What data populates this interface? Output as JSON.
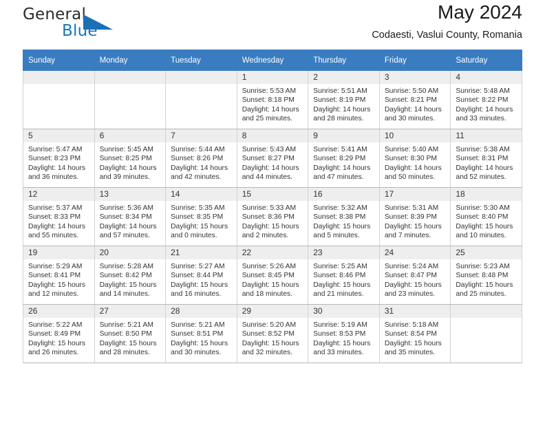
{
  "brand": {
    "line1": "General",
    "line2": "Blue",
    "triangle_icon": "triangle-icon",
    "color_dark": "#2b2b2b",
    "color_blue": "#1b75bb"
  },
  "header": {
    "title": "May 2024",
    "subtitle": "Codaesti, Vaslui County, Romania"
  },
  "theme": {
    "header_bg": "#3a7cc0",
    "daynum_bg": "#eeeeee",
    "grid_border": "#d2d2d2",
    "text": "#333333"
  },
  "weekdays": [
    "Sunday",
    "Monday",
    "Tuesday",
    "Wednesday",
    "Thursday",
    "Friday",
    "Saturday"
  ],
  "labels": {
    "sunrise": "Sunrise:",
    "sunset": "Sunset:",
    "daylight": "Daylight:"
  },
  "weeks": [
    [
      {
        "day": "",
        "blank": true
      },
      {
        "day": "",
        "blank": true
      },
      {
        "day": "",
        "blank": true
      },
      {
        "day": "1",
        "sunrise": "Sunrise: 5:53 AM",
        "sunset": "Sunset: 8:18 PM",
        "daylight1": "Daylight: 14 hours",
        "daylight2": "and 25 minutes."
      },
      {
        "day": "2",
        "sunrise": "Sunrise: 5:51 AM",
        "sunset": "Sunset: 8:19 PM",
        "daylight1": "Daylight: 14 hours",
        "daylight2": "and 28 minutes."
      },
      {
        "day": "3",
        "sunrise": "Sunrise: 5:50 AM",
        "sunset": "Sunset: 8:21 PM",
        "daylight1": "Daylight: 14 hours",
        "daylight2": "and 30 minutes."
      },
      {
        "day": "4",
        "sunrise": "Sunrise: 5:48 AM",
        "sunset": "Sunset: 8:22 PM",
        "daylight1": "Daylight: 14 hours",
        "daylight2": "and 33 minutes."
      }
    ],
    [
      {
        "day": "5",
        "sunrise": "Sunrise: 5:47 AM",
        "sunset": "Sunset: 8:23 PM",
        "daylight1": "Daylight: 14 hours",
        "daylight2": "and 36 minutes."
      },
      {
        "day": "6",
        "sunrise": "Sunrise: 5:45 AM",
        "sunset": "Sunset: 8:25 PM",
        "daylight1": "Daylight: 14 hours",
        "daylight2": "and 39 minutes."
      },
      {
        "day": "7",
        "sunrise": "Sunrise: 5:44 AM",
        "sunset": "Sunset: 8:26 PM",
        "daylight1": "Daylight: 14 hours",
        "daylight2": "and 42 minutes."
      },
      {
        "day": "8",
        "sunrise": "Sunrise: 5:43 AM",
        "sunset": "Sunset: 8:27 PM",
        "daylight1": "Daylight: 14 hours",
        "daylight2": "and 44 minutes."
      },
      {
        "day": "9",
        "sunrise": "Sunrise: 5:41 AM",
        "sunset": "Sunset: 8:29 PM",
        "daylight1": "Daylight: 14 hours",
        "daylight2": "and 47 minutes."
      },
      {
        "day": "10",
        "sunrise": "Sunrise: 5:40 AM",
        "sunset": "Sunset: 8:30 PM",
        "daylight1": "Daylight: 14 hours",
        "daylight2": "and 50 minutes."
      },
      {
        "day": "11",
        "sunrise": "Sunrise: 5:38 AM",
        "sunset": "Sunset: 8:31 PM",
        "daylight1": "Daylight: 14 hours",
        "daylight2": "and 52 minutes."
      }
    ],
    [
      {
        "day": "12",
        "sunrise": "Sunrise: 5:37 AM",
        "sunset": "Sunset: 8:33 PM",
        "daylight1": "Daylight: 14 hours",
        "daylight2": "and 55 minutes."
      },
      {
        "day": "13",
        "sunrise": "Sunrise: 5:36 AM",
        "sunset": "Sunset: 8:34 PM",
        "daylight1": "Daylight: 14 hours",
        "daylight2": "and 57 minutes."
      },
      {
        "day": "14",
        "sunrise": "Sunrise: 5:35 AM",
        "sunset": "Sunset: 8:35 PM",
        "daylight1": "Daylight: 15 hours",
        "daylight2": "and 0 minutes."
      },
      {
        "day": "15",
        "sunrise": "Sunrise: 5:33 AM",
        "sunset": "Sunset: 8:36 PM",
        "daylight1": "Daylight: 15 hours",
        "daylight2": "and 2 minutes."
      },
      {
        "day": "16",
        "sunrise": "Sunrise: 5:32 AM",
        "sunset": "Sunset: 8:38 PM",
        "daylight1": "Daylight: 15 hours",
        "daylight2": "and 5 minutes."
      },
      {
        "day": "17",
        "sunrise": "Sunrise: 5:31 AM",
        "sunset": "Sunset: 8:39 PM",
        "daylight1": "Daylight: 15 hours",
        "daylight2": "and 7 minutes."
      },
      {
        "day": "18",
        "sunrise": "Sunrise: 5:30 AM",
        "sunset": "Sunset: 8:40 PM",
        "daylight1": "Daylight: 15 hours",
        "daylight2": "and 10 minutes."
      }
    ],
    [
      {
        "day": "19",
        "sunrise": "Sunrise: 5:29 AM",
        "sunset": "Sunset: 8:41 PM",
        "daylight1": "Daylight: 15 hours",
        "daylight2": "and 12 minutes."
      },
      {
        "day": "20",
        "sunrise": "Sunrise: 5:28 AM",
        "sunset": "Sunset: 8:42 PM",
        "daylight1": "Daylight: 15 hours",
        "daylight2": "and 14 minutes."
      },
      {
        "day": "21",
        "sunrise": "Sunrise: 5:27 AM",
        "sunset": "Sunset: 8:44 PM",
        "daylight1": "Daylight: 15 hours",
        "daylight2": "and 16 minutes."
      },
      {
        "day": "22",
        "sunrise": "Sunrise: 5:26 AM",
        "sunset": "Sunset: 8:45 PM",
        "daylight1": "Daylight: 15 hours",
        "daylight2": "and 18 minutes."
      },
      {
        "day": "23",
        "sunrise": "Sunrise: 5:25 AM",
        "sunset": "Sunset: 8:46 PM",
        "daylight1": "Daylight: 15 hours",
        "daylight2": "and 21 minutes."
      },
      {
        "day": "24",
        "sunrise": "Sunrise: 5:24 AM",
        "sunset": "Sunset: 8:47 PM",
        "daylight1": "Daylight: 15 hours",
        "daylight2": "and 23 minutes."
      },
      {
        "day": "25",
        "sunrise": "Sunrise: 5:23 AM",
        "sunset": "Sunset: 8:48 PM",
        "daylight1": "Daylight: 15 hours",
        "daylight2": "and 25 minutes."
      }
    ],
    [
      {
        "day": "26",
        "sunrise": "Sunrise: 5:22 AM",
        "sunset": "Sunset: 8:49 PM",
        "daylight1": "Daylight: 15 hours",
        "daylight2": "and 26 minutes."
      },
      {
        "day": "27",
        "sunrise": "Sunrise: 5:21 AM",
        "sunset": "Sunset: 8:50 PM",
        "daylight1": "Daylight: 15 hours",
        "daylight2": "and 28 minutes."
      },
      {
        "day": "28",
        "sunrise": "Sunrise: 5:21 AM",
        "sunset": "Sunset: 8:51 PM",
        "daylight1": "Daylight: 15 hours",
        "daylight2": "and 30 minutes."
      },
      {
        "day": "29",
        "sunrise": "Sunrise: 5:20 AM",
        "sunset": "Sunset: 8:52 PM",
        "daylight1": "Daylight: 15 hours",
        "daylight2": "and 32 minutes."
      },
      {
        "day": "30",
        "sunrise": "Sunrise: 5:19 AM",
        "sunset": "Sunset: 8:53 PM",
        "daylight1": "Daylight: 15 hours",
        "daylight2": "and 33 minutes."
      },
      {
        "day": "31",
        "sunrise": "Sunrise: 5:18 AM",
        "sunset": "Sunset: 8:54 PM",
        "daylight1": "Daylight: 15 hours",
        "daylight2": "and 35 minutes."
      },
      {
        "day": "",
        "blank": true
      }
    ]
  ]
}
